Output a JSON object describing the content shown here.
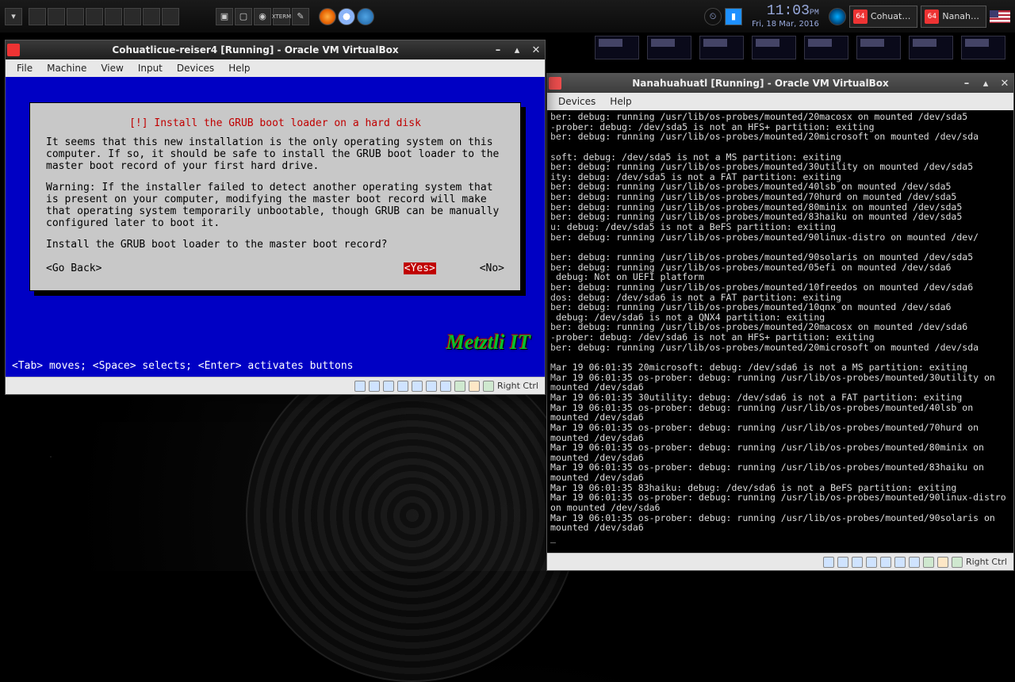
{
  "panel": {
    "clock_time": "11:03",
    "clock_ampm": "PM",
    "clock_date": "Fri, 18 Mar, 2016",
    "task1": "Cohuat…",
    "task2": "Nanah…",
    "task_badge": "64"
  },
  "win1": {
    "title": "Cohuatlicue-reiser4 [Running] - Oracle VM VirtualBox",
    "menus": [
      "File",
      "Machine",
      "View",
      "Input",
      "Devices",
      "Help"
    ],
    "dialog_title": "[!] Install the GRUB boot loader on a hard disk",
    "para1": "It seems that this new installation is the only operating system on this computer. If so, it should be safe to install the GRUB boot loader to the master boot record of your first hard drive.",
    "para2": "Warning: If the installer failed to detect another operating system that is present on your computer, modifying the master boot record will make that operating system temporarily unbootable, though GRUB can be manually configured later to boot it.",
    "question": "Install the GRUB boot loader to the master boot record?",
    "go_back": "<Go Back>",
    "yes": "<Yes>",
    "no": "<No>",
    "helpline": "<Tab> moves; <Space> selects; <Enter> activates buttons",
    "brand": "Metztli IT",
    "hostkey": "Right Ctrl"
  },
  "win2": {
    "title": "Nanahuahuatl [Running] - Oracle VM VirtualBox",
    "menus": [
      "Devices",
      "Help"
    ],
    "hostkey": "Right Ctrl",
    "log": "ber: debug: running /usr/lib/os-probes/mounted/20macosx on mounted /dev/sda5\n-prober: debug: /dev/sda5 is not an HFS+ partition: exiting\nber: debug: running /usr/lib/os-probes/mounted/20microsoft on mounted /dev/sda\n\nsoft: debug: /dev/sda5 is not a MS partition: exiting\nber: debug: running /usr/lib/os-probes/mounted/30utility on mounted /dev/sda5\nity: debug: /dev/sda5 is not a FAT partition: exiting\nber: debug: running /usr/lib/os-probes/mounted/40lsb on mounted /dev/sda5\nber: debug: running /usr/lib/os-probes/mounted/70hurd on mounted /dev/sda5\nber: debug: running /usr/lib/os-probes/mounted/80minix on mounted /dev/sda5\nber: debug: running /usr/lib/os-probes/mounted/83haiku on mounted /dev/sda5\nu: debug: /dev/sda5 is not a BeFS partition: exiting\nber: debug: running /usr/lib/os-probes/mounted/90linux-distro on mounted /dev/\n\nber: debug: running /usr/lib/os-probes/mounted/90solaris on mounted /dev/sda5\nber: debug: running /usr/lib/os-probes/mounted/05efi on mounted /dev/sda6\n debug: Not on UEFI platform\nber: debug: running /usr/lib/os-probes/mounted/10freedos on mounted /dev/sda6\ndos: debug: /dev/sda6 is not a FAT partition: exiting\nber: debug: running /usr/lib/os-probes/mounted/10qnx on mounted /dev/sda6\n debug: /dev/sda6 is not a QNX4 partition: exiting\nber: debug: running /usr/lib/os-probes/mounted/20macosx on mounted /dev/sda6\n-prober: debug: /dev/sda6 is not an HFS+ partition: exiting\nber: debug: running /usr/lib/os-probes/mounted/20microsoft on mounted /dev/sda\n\nMar 19 06:01:35 20microsoft: debug: /dev/sda6 is not a MS partition: exiting\nMar 19 06:01:35 os-prober: debug: running /usr/lib/os-probes/mounted/30utility on mounted /dev/sda6\nMar 19 06:01:35 30utility: debug: /dev/sda6 is not a FAT partition: exiting\nMar 19 06:01:35 os-prober: debug: running /usr/lib/os-probes/mounted/40lsb on mounted /dev/sda6\nMar 19 06:01:35 os-prober: debug: running /usr/lib/os-probes/mounted/70hurd on mounted /dev/sda6\nMar 19 06:01:35 os-prober: debug: running /usr/lib/os-probes/mounted/80minix on mounted /dev/sda6\nMar 19 06:01:35 os-prober: debug: running /usr/lib/os-probes/mounted/83haiku on mounted /dev/sda6\nMar 19 06:01:35 83haiku: debug: /dev/sda6 is not a BeFS partition: exiting\nMar 19 06:01:35 os-prober: debug: running /usr/lib/os-probes/mounted/90linux-distro on mounted /dev/sda6\nMar 19 06:01:35 os-prober: debug: running /usr/lib/os-probes/mounted/90solaris on mounted /dev/sda6\n_"
  }
}
